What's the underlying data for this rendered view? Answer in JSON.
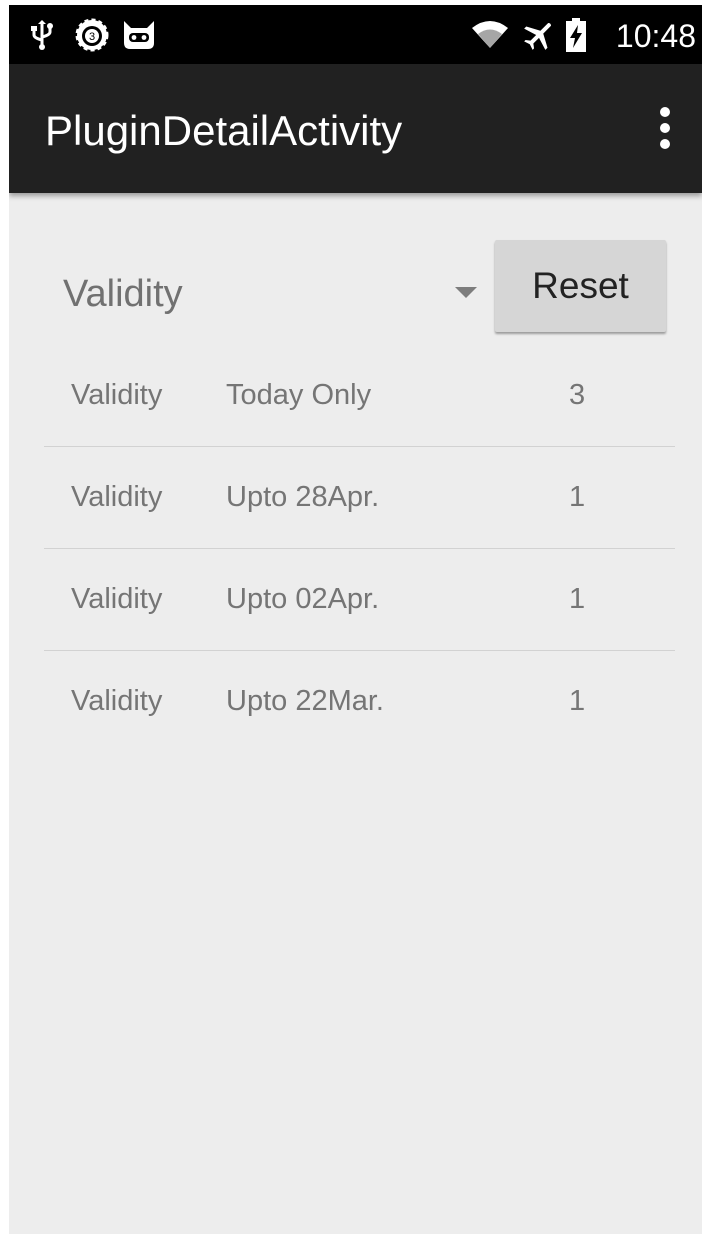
{
  "status_bar": {
    "time": "10:48",
    "left_icons": [
      "usb-icon",
      "updates-badge-icon",
      "cyanogen-mascot-icon"
    ],
    "right_icons": [
      "wifi-icon",
      "airplane-mode-icon",
      "battery-charging-icon"
    ],
    "updates_badge_count": "3"
  },
  "action_bar": {
    "title": "PluginDetailActivity",
    "overflow_icon": "more-vert-icon"
  },
  "filter": {
    "spinner_value": "Validity",
    "reset_label": "Reset"
  },
  "list": {
    "rows": [
      {
        "key": "Validity",
        "value": "Today Only",
        "count": "3"
      },
      {
        "key": "Validity",
        "value": "Upto 28Apr.",
        "count": "1"
      },
      {
        "key": "Validity",
        "value": "Upto 02Apr.",
        "count": "1"
      },
      {
        "key": "Validity",
        "value": "Upto 22Mar.",
        "count": "1"
      }
    ]
  },
  "colors": {
    "status_bar": "#000000",
    "action_bar": "#212121",
    "background": "#ededed",
    "button": "#d6d6d6"
  }
}
